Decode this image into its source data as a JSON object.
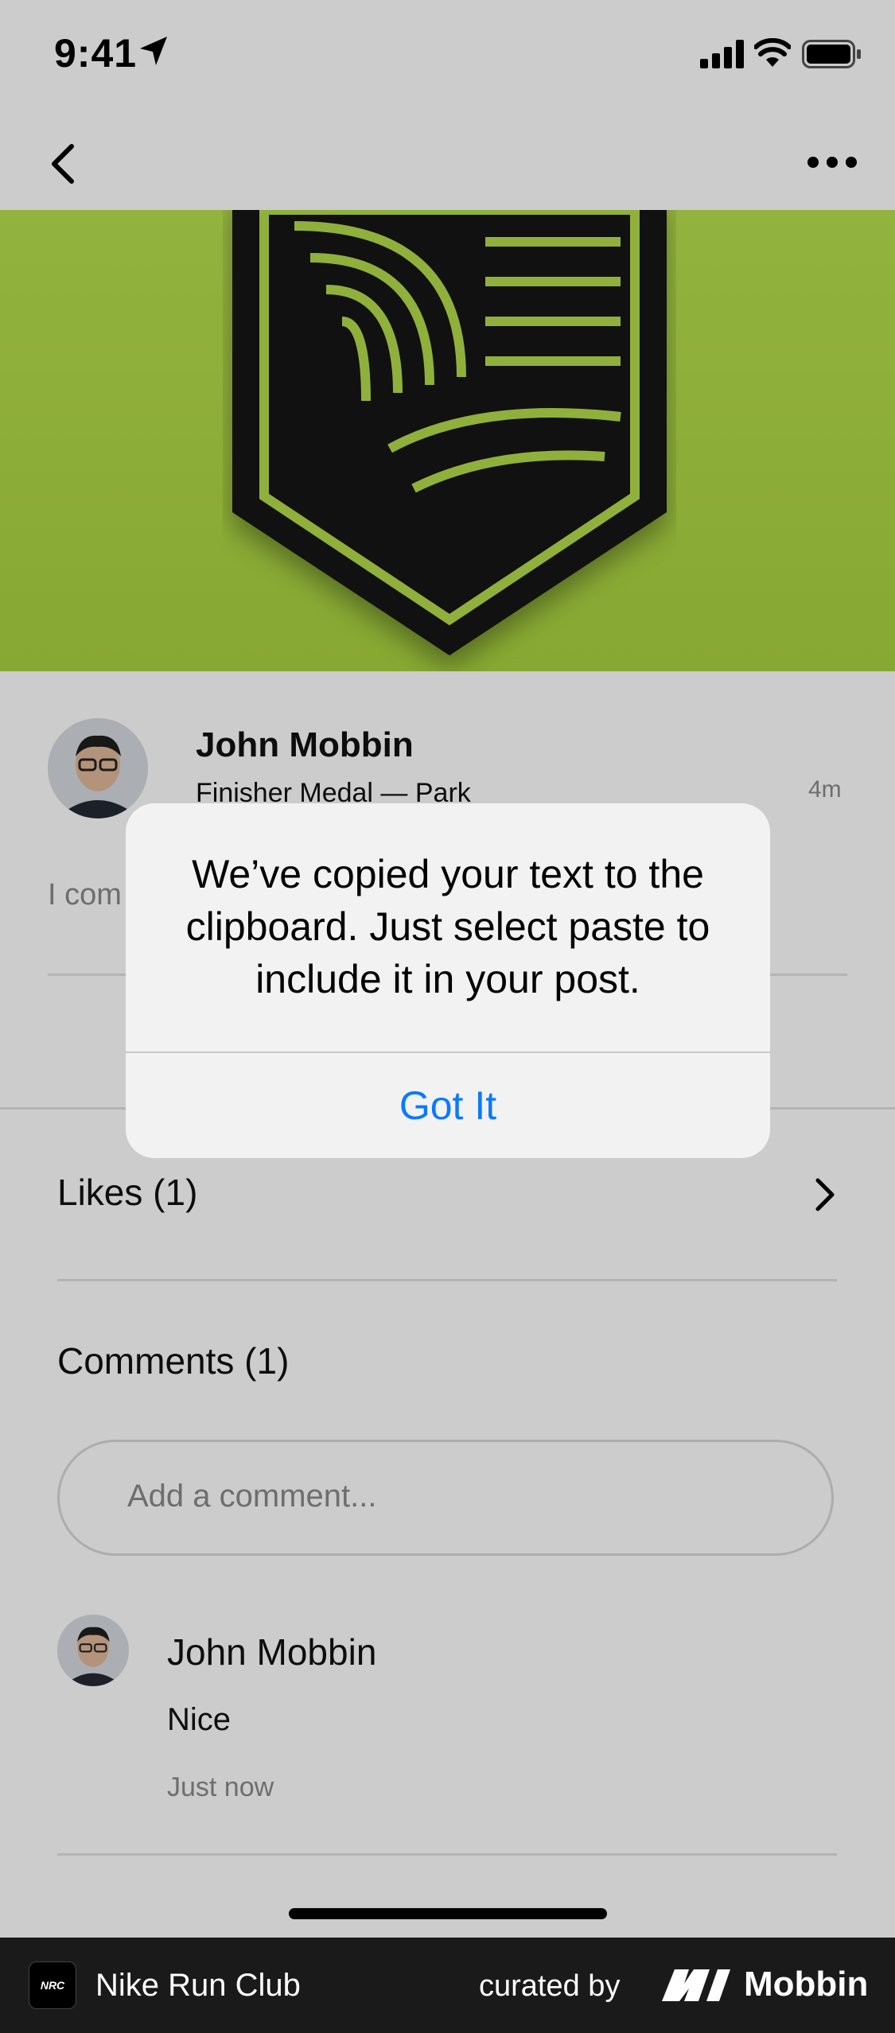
{
  "status_bar": {
    "time": "9:41"
  },
  "post": {
    "author": "John Mobbin",
    "subtitle": "Finisher Medal — Park",
    "time_ago": "4m",
    "text_preview": "I com"
  },
  "likes": {
    "label": "Likes (1)"
  },
  "comments": {
    "label": "Comments (1)",
    "input_placeholder": "Add a comment...",
    "items": [
      {
        "author": "John Mobbin",
        "text": "Nice",
        "time": "Just now"
      }
    ]
  },
  "alert": {
    "message": "We’ve copied your text to the clipboard. Just select paste to include it in your post.",
    "button_label": "Got It"
  },
  "footer": {
    "app_name": "Nike Run Club",
    "curated_by": "curated by",
    "brand": "Mobbin",
    "app_icon_text": "NRC"
  },
  "colors": {
    "hero_green": "#b5dd4b",
    "alert_button": "#0a79ff",
    "footer_bg": "#1a1a1a"
  },
  "icons": [
    "location-arrow-icon",
    "signal-icon",
    "wifi-icon",
    "battery-icon",
    "back-chevron-icon",
    "more-icon",
    "chevron-right-icon"
  ]
}
